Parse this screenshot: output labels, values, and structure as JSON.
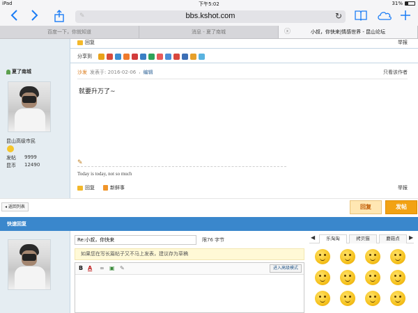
{
  "status_bar": {
    "device": "iPad",
    "time": "下午5:02",
    "battery": "31%"
  },
  "browser": {
    "url": "bbs.kshot.com",
    "tabs": [
      {
        "label": "百度一下，你就知道",
        "active": false
      },
      {
        "label": "消息 - 夏了南城",
        "active": false
      },
      {
        "label": "小叔，你快来|情感世界 - 昆山论坛",
        "active": true
      }
    ],
    "close_glyph": "ⓧ"
  },
  "post_top": {
    "reply_label": "回复",
    "report_label": "举报",
    "share_label": "分享到"
  },
  "share_icons": [
    "#e9a21a",
    "#d84b3b",
    "#3d8fd1",
    "#ef7b2d",
    "#d23c3c",
    "#3a7fc4",
    "#2fa35a",
    "#e85a5a",
    "#4c8ed6",
    "#d9473d",
    "#3c6fb5",
    "#e6a02b",
    "#59b3e0"
  ],
  "post": {
    "username": "夏了南城",
    "author_label": "沙发",
    "posted_on": "发表于: 2016-02-06",
    "edit_label": "编辑",
    "only_author": "只看该作者",
    "content": "就要升万了~",
    "rank": "昆山高级市民",
    "stats": [
      {
        "label": "发帖",
        "value": "9999"
      },
      {
        "label": "昆币",
        "value": "12490"
      }
    ],
    "signature": "Today is today, not so much",
    "reply_label": "回复",
    "fresh_label": "新鲜事",
    "report_label": "举报"
  },
  "actions": {
    "back_list": "◂ 返回列表",
    "reply": "回复",
    "post": "发帖"
  },
  "quick_reply": {
    "title": "快速回复",
    "subject_value": "Re:小叔，你快来",
    "limit_text": "限76 字节",
    "notice": "如果您在写长篇帖子又不马上发表，建议存为草稿",
    "advanced_mode": "进入高级模式",
    "toolbar": {
      "bold": "B",
      "color": "A",
      "link": "∞",
      "image": "▣",
      "attach": "✎"
    }
  },
  "smiley_panel": {
    "prev": "◀",
    "next": "▶",
    "tabs": [
      {
        "label": "乐淘淘",
        "active": true
      },
      {
        "label": "拷贝猫",
        "active": false
      },
      {
        "label": "蘑菇点",
        "active": false
      }
    ],
    "count": 12
  },
  "icons": {
    "back": "back-icon",
    "forward": "forward-icon",
    "share": "share-icon",
    "bookmarks": "bookmarks-icon",
    "cloud": "cloud-tabs-icon",
    "new_tab": "new-tab-icon",
    "reload": "reload-icon"
  },
  "colors": {
    "accent": "#1a7cf5",
    "quick_reply_header": "#3a87cc",
    "post_button": "#f2a213",
    "sidebar": "#e5edf2"
  }
}
